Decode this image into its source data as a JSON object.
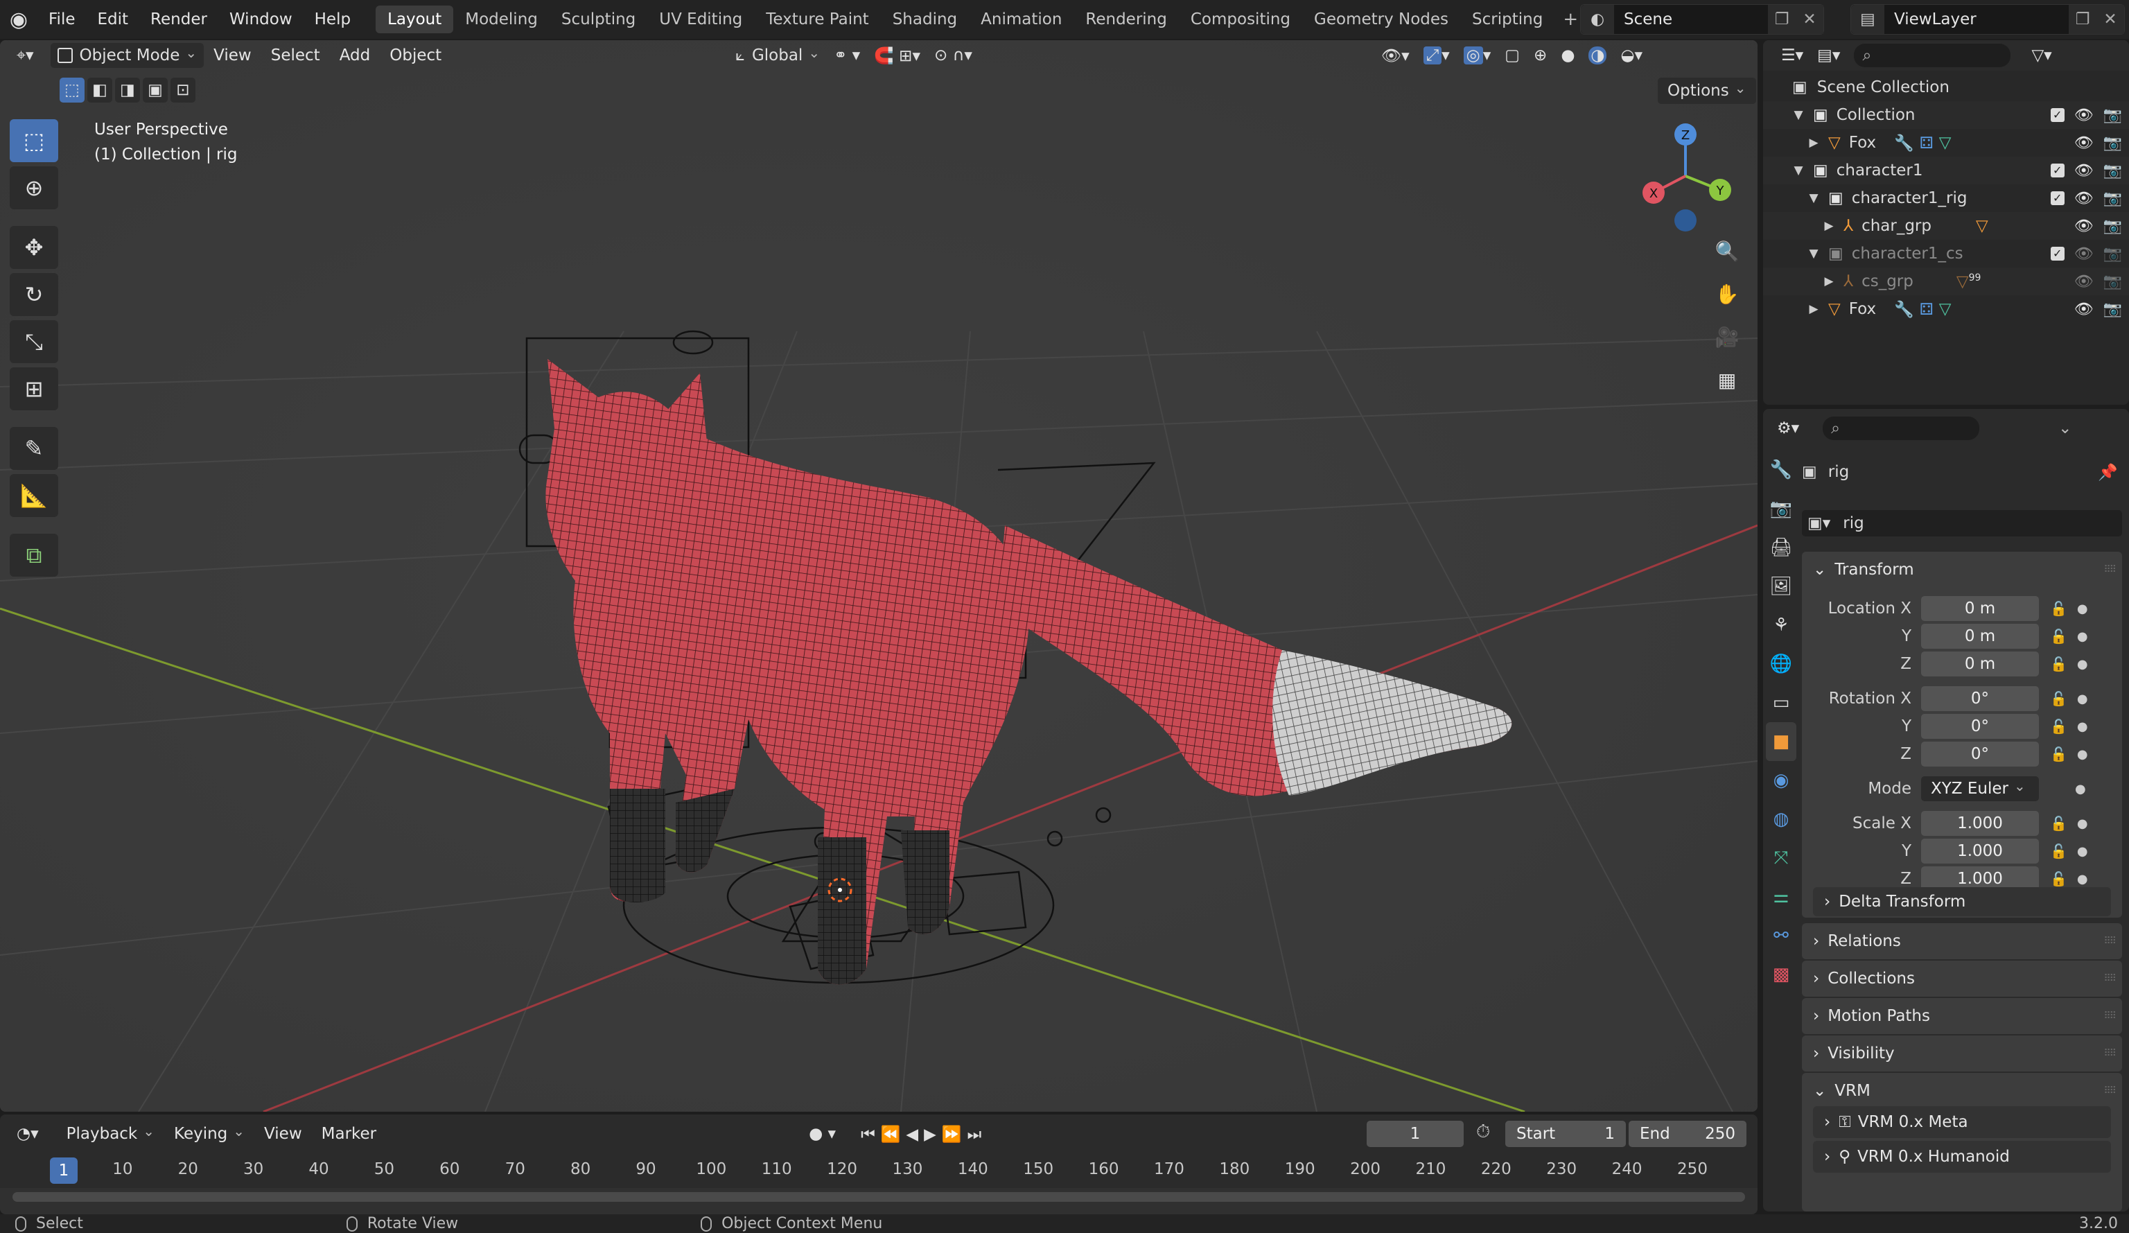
{
  "menus": [
    "File",
    "Edit",
    "Render",
    "Window",
    "Help"
  ],
  "workspaces": [
    "Layout",
    "Modeling",
    "Sculpting",
    "UV Editing",
    "Texture Paint",
    "Shading",
    "Animation",
    "Rendering",
    "Compositing",
    "Geometry Nodes",
    "Scripting"
  ],
  "scene": {
    "name": "Scene",
    "view_layer": "ViewLayer"
  },
  "viewport": {
    "mode": "Object Mode",
    "menus": [
      "View",
      "Select",
      "Add",
      "Object"
    ],
    "orientation": "Global",
    "options": "Options",
    "overlay_line1": "User Perspective",
    "overlay_line2": "(1) Collection | rig",
    "gizmo_axes": [
      "X",
      "Y",
      "Z"
    ]
  },
  "timeline": {
    "menus": [
      "Playback",
      "Keying",
      "View",
      "Marker"
    ],
    "current_frame": "1",
    "start_label": "Start",
    "start": "1",
    "end_label": "End",
    "end": "250",
    "ruler": [
      "1",
      "10",
      "20",
      "30",
      "40",
      "50",
      "60",
      "70",
      "80",
      "90",
      "100",
      "110",
      "120",
      "130",
      "140",
      "150",
      "160",
      "170",
      "180",
      "190",
      "200",
      "210",
      "220",
      "230",
      "240",
      "250"
    ]
  },
  "status": {
    "left": "Select",
    "middle": "Rotate View",
    "right": "Object Context Menu",
    "version": "3.2.0"
  },
  "outliner": {
    "scene_collection": "Scene Collection",
    "rows": [
      {
        "label": "Collection",
        "depth": 1,
        "kind": "collection"
      },
      {
        "label": "Fox",
        "depth": 2,
        "kind": "mesh"
      },
      {
        "label": "character1",
        "depth": 1,
        "kind": "collection"
      },
      {
        "label": "character1_rig",
        "depth": 2,
        "kind": "collection"
      },
      {
        "label": "char_grp",
        "depth": 3,
        "kind": "armature"
      },
      {
        "label": "character1_cs",
        "depth": 2,
        "kind": "collection-dim"
      },
      {
        "label": "cs_grp",
        "depth": 3,
        "kind": "armature-dim"
      },
      {
        "label": "Fox",
        "depth": 2,
        "kind": "mesh"
      }
    ],
    "badge": "99"
  },
  "properties": {
    "object_name": "rig",
    "data_name": "rig",
    "transform_title": "Transform",
    "location_label": "Location X",
    "location": [
      "0 m",
      "0 m",
      "0 m"
    ],
    "rotation_label": "Rotation X",
    "rotation": [
      "0°",
      "0°",
      "0°"
    ],
    "mode_label": "Mode",
    "mode": "XYZ Euler",
    "scale_label": "Scale X",
    "scale": [
      "1.000",
      "1.000",
      "1.000"
    ],
    "axis_y": "Y",
    "axis_z": "Z",
    "delta": "Delta Transform",
    "panels": [
      "Relations",
      "Collections",
      "Motion Paths",
      "Visibility"
    ],
    "vrm": "VRM",
    "vrm_items": [
      "VRM 0.x Meta",
      "VRM 0.x Humanoid"
    ]
  },
  "colors": {
    "accent": "#4772b3",
    "fox_body": "#c94a54",
    "fox_tail_tip": "#d6d6d6",
    "x_axis": "#e05562",
    "y_axis": "#8cc63f",
    "z_axis": "#4f8ddb"
  }
}
